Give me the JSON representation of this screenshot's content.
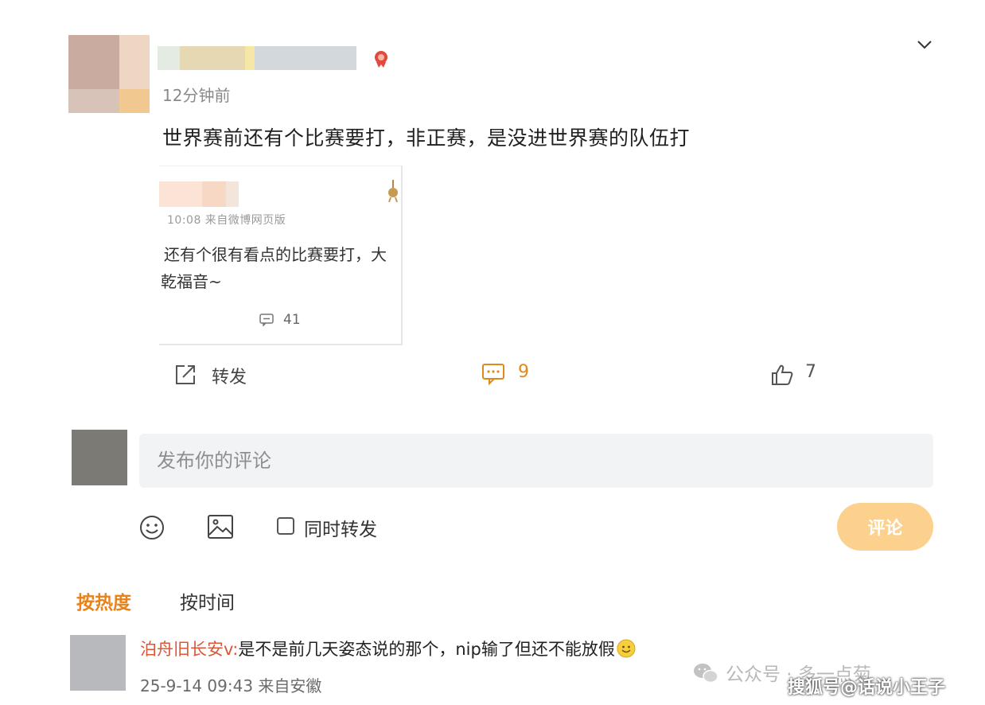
{
  "post": {
    "time": "12分钟前",
    "text": "世界赛前还有个比赛要打，非正赛，是没进世界赛的队伍打"
  },
  "embedded_card": {
    "meta": "10:08  来自微博网页版",
    "text_line1": "还有个很有看点的比赛要打，大",
    "text_line2": "乾福音~",
    "comment_count": "41"
  },
  "actions": {
    "forward_label": "转发",
    "comment_count": "9",
    "like_count": "7"
  },
  "composer": {
    "placeholder": "发布你的评论",
    "repost_label": "同时转发",
    "submit_label": "评论"
  },
  "sort_tabs": {
    "hot": "按热度",
    "time": "按时间"
  },
  "reply": {
    "user": "泊舟旧长安v:",
    "text": "是不是前几天姿态说的那个，nip输了但还不能放假",
    "meta": "25-9-14 09:43 来自安徽"
  },
  "watermarks": {
    "wechat": "公众号 · 多一点菊",
    "sohu": "搜狐号@话说小王子"
  },
  "colors": {
    "accent": "#e8831a",
    "submit_bg": "#fcd18e",
    "reply_user": "#d9573a"
  },
  "icons": {
    "chevron": "chevron-down-icon",
    "forward": "share-icon",
    "comment": "comment-icon",
    "like": "thumbs-up-icon",
    "emoji": "smiley-icon",
    "image": "image-icon"
  }
}
